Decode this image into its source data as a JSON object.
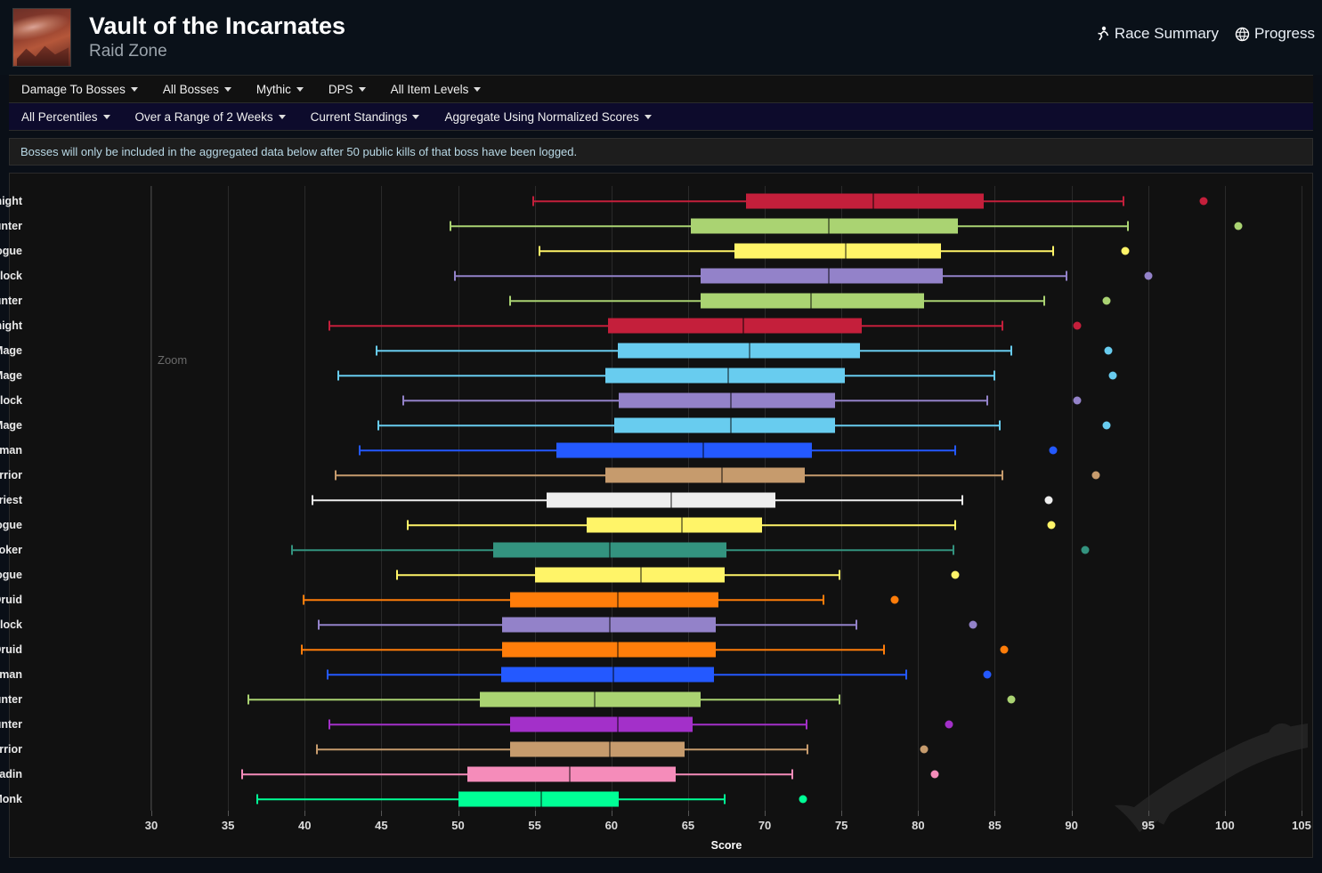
{
  "header": {
    "title": "Vault of the Incarnates",
    "subtitle": "Raid Zone",
    "links": [
      {
        "label": "Race Summary",
        "icon": "runner-icon"
      },
      {
        "label": "Progress",
        "icon": "globe-icon"
      }
    ]
  },
  "filters_primary": [
    {
      "label": "Damage To Bosses"
    },
    {
      "label": "All Bosses"
    },
    {
      "label": "Mythic"
    },
    {
      "label": "DPS"
    },
    {
      "label": "All Item Levels"
    }
  ],
  "filters_secondary": [
    {
      "label": "All Percentiles"
    },
    {
      "label": "Over a Range of 2 Weeks"
    },
    {
      "label": "Current Standings"
    },
    {
      "label": "Aggregate Using Normalized Scores"
    }
  ],
  "notice": "Bosses will only be included in the aggregated data below after 50 public kills of that boss have been logged.",
  "chart_controls": {
    "zoom_label": "Zoom"
  },
  "chart_data": {
    "type": "boxplot",
    "title": "",
    "xlabel": "Score",
    "ylabel": "",
    "xlim": [
      30,
      105
    ],
    "xticks": [
      30,
      35,
      40,
      45,
      50,
      55,
      60,
      65,
      70,
      75,
      80,
      85,
      90,
      95,
      100,
      105
    ],
    "grid": true,
    "legend": "none",
    "categories": [
      "Unholy Death Knight",
      "Beast Mastery Hunter",
      "Assassination Rogue",
      "Affliction Warlock",
      "Survival Hunter",
      "Frost Death Knight",
      "Frost Mage",
      "Arcane Mage",
      "Destruction Warlock",
      "Fire Mage",
      "Enhancement Shaman",
      "Arms Warrior",
      "Shadow Priest",
      "Subtlety Rogue",
      "Devastation Evoker",
      "Outlaw Rogue",
      "Balance Druid",
      "Demonology Warlock",
      "Feral Druid",
      "Elemental Shaman",
      "Marksmanship Hunter",
      "Havoc Demon Hunter",
      "Fury Warrior",
      "Retribution Paladin",
      "Windwalker Monk"
    ],
    "boxes": [
      {
        "name": "Unholy Death Knight",
        "color": "#c41f3b",
        "min": 54.9,
        "q1": 68.8,
        "median": 77.1,
        "q3": 84.3,
        "max": 93.4,
        "outlier": 98.6
      },
      {
        "name": "Beast Mastery Hunter",
        "color": "#aad372",
        "min": 49.5,
        "q1": 65.2,
        "median": 74.2,
        "q3": 82.6,
        "max": 93.7,
        "outlier": 100.9
      },
      {
        "name": "Assassination Rogue",
        "color": "#fff468",
        "min": 55.3,
        "q1": 68.0,
        "median": 75.3,
        "q3": 81.5,
        "max": 88.8,
        "outlier": 93.5
      },
      {
        "name": "Affliction Warlock",
        "color": "#9382c9",
        "min": 49.8,
        "q1": 65.8,
        "median": 74.2,
        "q3": 81.6,
        "max": 89.7,
        "outlier": 95.0
      },
      {
        "name": "Survival Hunter",
        "color": "#aad372",
        "min": 53.4,
        "q1": 65.8,
        "median": 73.0,
        "q3": 80.4,
        "max": 88.2,
        "outlier": 92.3
      },
      {
        "name": "Frost Death Knight",
        "color": "#c41f3b",
        "min": 41.6,
        "q1": 59.8,
        "median": 68.6,
        "q3": 76.3,
        "max": 85.5,
        "outlier": 90.4
      },
      {
        "name": "Frost Mage",
        "color": "#68ccef",
        "min": 44.7,
        "q1": 60.4,
        "median": 69.0,
        "q3": 76.2,
        "max": 86.1,
        "outlier": 92.4
      },
      {
        "name": "Arcane Mage",
        "color": "#68ccef",
        "min": 42.2,
        "q1": 59.6,
        "median": 67.6,
        "q3": 75.2,
        "max": 85.0,
        "outlier": 92.7
      },
      {
        "name": "Destruction Warlock",
        "color": "#9382c9",
        "min": 46.4,
        "q1": 60.5,
        "median": 67.8,
        "q3": 74.6,
        "max": 84.5,
        "outlier": 90.4
      },
      {
        "name": "Fire Mage",
        "color": "#68ccef",
        "min": 44.8,
        "q1": 60.2,
        "median": 67.8,
        "q3": 74.6,
        "max": 85.3,
        "outlier": 92.3
      },
      {
        "name": "Enhancement Shaman",
        "color": "#2459ff",
        "min": 43.6,
        "q1": 56.4,
        "median": 66.0,
        "q3": 73.1,
        "max": 82.4,
        "outlier": 88.8
      },
      {
        "name": "Arms Warrior",
        "color": "#c69b6d",
        "min": 42.0,
        "q1": 59.6,
        "median": 67.2,
        "q3": 72.6,
        "max": 85.5,
        "outlier": 91.6
      },
      {
        "name": "Shadow Priest",
        "color": "#eeeeee",
        "min": 40.5,
        "q1": 55.8,
        "median": 63.9,
        "q3": 70.7,
        "max": 82.9,
        "outlier": 88.5
      },
      {
        "name": "Subtlety Rogue",
        "color": "#fff468",
        "min": 46.7,
        "q1": 58.4,
        "median": 64.6,
        "q3": 69.8,
        "max": 82.4,
        "outlier": 88.7
      },
      {
        "name": "Devastation Evoker",
        "color": "#33937f",
        "min": 39.2,
        "q1": 52.3,
        "median": 59.9,
        "q3": 67.5,
        "max": 82.3,
        "outlier": 90.9
      },
      {
        "name": "Outlaw Rogue",
        "color": "#fff468",
        "min": 46.0,
        "q1": 55.0,
        "median": 61.9,
        "q3": 67.4,
        "max": 74.9,
        "outlier": 82.4
      },
      {
        "name": "Balance Druid",
        "color": "#ff7d0a",
        "min": 39.9,
        "q1": 53.4,
        "median": 60.4,
        "q3": 67.0,
        "max": 73.8,
        "outlier": 78.5
      },
      {
        "name": "Demonology Warlock",
        "color": "#9382c9",
        "min": 40.9,
        "q1": 52.9,
        "median": 59.9,
        "q3": 66.8,
        "max": 76.0,
        "outlier": 83.6
      },
      {
        "name": "Feral Druid",
        "color": "#ff7d0a",
        "min": 39.8,
        "q1": 52.9,
        "median": 60.4,
        "q3": 66.8,
        "max": 77.8,
        "outlier": 85.6
      },
      {
        "name": "Elemental Shaman",
        "color": "#2459ff",
        "min": 41.5,
        "q1": 52.8,
        "median": 60.1,
        "q3": 66.7,
        "max": 79.2,
        "outlier": 84.5
      },
      {
        "name": "Marksmanship Hunter",
        "color": "#aad372",
        "min": 36.3,
        "q1": 51.4,
        "median": 58.9,
        "q3": 65.8,
        "max": 74.9,
        "outlier": 86.1
      },
      {
        "name": "Havoc Demon Hunter",
        "color": "#a330c9",
        "min": 41.6,
        "q1": 53.4,
        "median": 60.4,
        "q3": 65.3,
        "max": 72.7,
        "outlier": 82.0
      },
      {
        "name": "Fury Warrior",
        "color": "#c69b6d",
        "min": 40.8,
        "q1": 53.4,
        "median": 59.9,
        "q3": 64.8,
        "max": 72.8,
        "outlier": 80.4
      },
      {
        "name": "Retribution Paladin",
        "color": "#f58cba",
        "min": 35.9,
        "q1": 50.6,
        "median": 57.3,
        "q3": 64.2,
        "max": 71.8,
        "outlier": 81.1
      },
      {
        "name": "Windwalker Monk",
        "color": "#00ff96",
        "min": 36.9,
        "q1": 50.0,
        "median": 55.4,
        "q3": 60.5,
        "max": 67.4,
        "outlier": 72.5
      }
    ]
  }
}
